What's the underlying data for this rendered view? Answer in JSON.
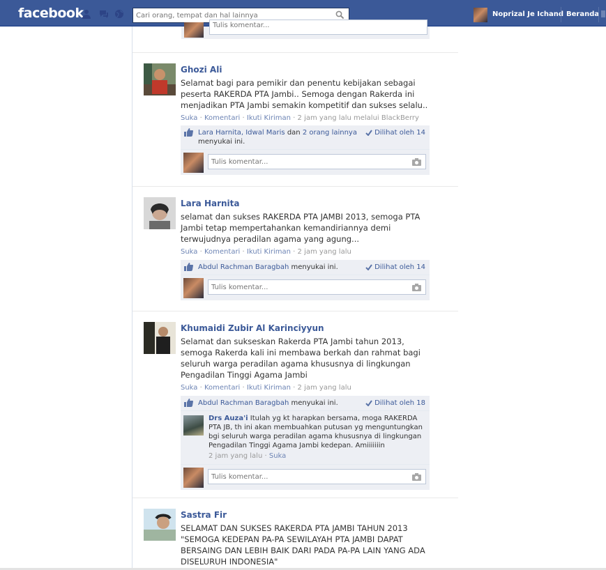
{
  "topbar": {
    "logo": "facebook",
    "search_placeholder": "Cari orang, tempat dan hal lainnya",
    "user_name": "Noprizal Je Ichand",
    "home_label": "Beranda"
  },
  "comment_placeholder": "Tulis komentar...",
  "posts": [
    {
      "author": "Ghozi Ali",
      "body": "Selamat bagi para pemikir dan penentu kebijakan sebagai peserta RAKERDA PTA Jambi.. Semoga dengan Rakerda ini menjadikan PTA Jambi semakin kompetitif dan sukses selalu..",
      "actions": {
        "like": "Suka",
        "comment": "Komentari",
        "follow": "Ikuti Kiriman",
        "meta": "2 jam yang lalu melalui BlackBerry"
      },
      "likes": {
        "names": "Lara Harnita, Idwal Maris",
        "conj": " dan ",
        "others": "2 orang lainnya",
        "suffix": "menyukai ini."
      },
      "seen": "Dilihat oleh 14"
    },
    {
      "author": "Lara Harnita",
      "body": "selamat dan sukses RAKERDA PTA JAMBI 2013, semoga PTA Jambi tetap mempertahankan kemandiriannya demi terwujudnya peradilan agama yang agung...",
      "actions": {
        "like": "Suka",
        "comment": "Komentari",
        "follow": "Ikuti Kiriman",
        "meta": "2 jam yang lalu"
      },
      "likes": {
        "names": "Abdul Rachman Baragbah",
        "suffix": " menyukai ini."
      },
      "seen": "Dilihat oleh 14"
    },
    {
      "author": "Khumaidi Zubir Al Karinciyyun",
      "body": "Selamat dan sukseskan Rakerda PTA Jambi tahun 2013, semoga Rakerda kali ini membawa berkah dan rahmat bagi seluruh warga peradilan agama khususnya di lingkungan Pengadilan Tinggi Agama Jambi",
      "actions": {
        "like": "Suka",
        "comment": "Komentari",
        "follow": "Ikuti Kiriman",
        "meta": "2 jam yang lalu"
      },
      "likes": {
        "names": "Abdul Rachman Baragbah",
        "suffix": " menyukai ini."
      },
      "seen": "Dilihat oleh 18",
      "reply": {
        "author": "Drs Auza'i",
        "text": " Itulah yg kt harapkan bersama, moga RAKERDA PTA JB, th ini akan membuahkan putusan yg menguntungkan bgi seluruh warga peradilan agama khususnya di lingkungan Pengadilan Tinggi Agama Jambi kedepan. Amiiiiiiin",
        "time": "2 jam yang lalu",
        "like": "Suka"
      }
    },
    {
      "author": "Sastra Fir",
      "body": "SELAMAT DAN SUKSES RAKERDA PTA JAMBI TAHUN 2013 \"SEMOGA KEDEPAN PA-PA SEWILAYAH PTA JAMBI DAPAT BERSAING DAN LEBIH BAIK DARI PADA PA-PA LAIN YANG ADA DISELURUH INDONESIA\""
    }
  ]
}
